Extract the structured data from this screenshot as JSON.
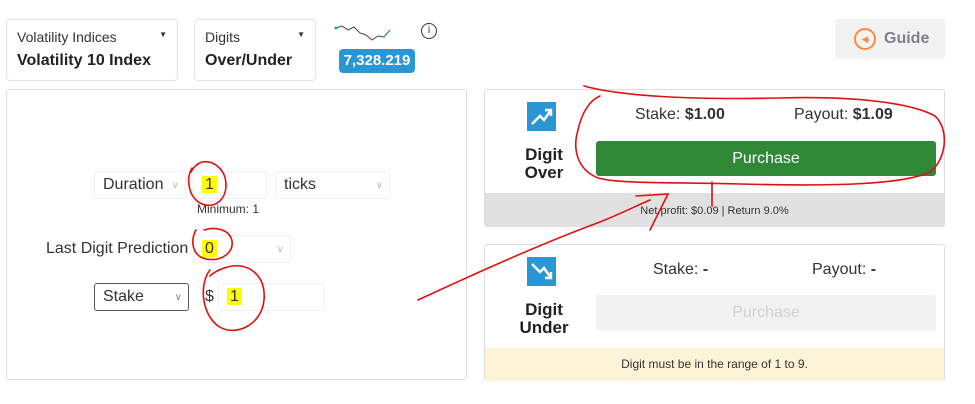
{
  "market": {
    "label": "Volatility Indices",
    "value": "Volatility 10 Index",
    "arrow": "▼"
  },
  "trade_type": {
    "label": "Digits",
    "value": "Over/Under",
    "arrow": "▼"
  },
  "price": "7,328.219",
  "info_icon": "i",
  "guide": {
    "label": "Guide",
    "icon": "compass-icon"
  },
  "form": {
    "duration": {
      "type": "Duration",
      "value": "1",
      "unit": "ticks",
      "minimum": "Minimum: 1"
    },
    "prediction": {
      "label": "Last Digit Prediction",
      "value": "0"
    },
    "stake": {
      "type": "Stake",
      "currency": "$",
      "value": "1"
    }
  },
  "contracts": [
    {
      "name_line1": "Digit",
      "name_line2": "Over",
      "stake_label": "Stake:",
      "stake_value": "$1.00",
      "payout_label": "Payout:",
      "payout_value": "$1.09",
      "button": "Purchase",
      "footer": "Net profit: $0.09 | Return 9.0%"
    },
    {
      "name_line1": "Digit",
      "name_line2": "Under",
      "stake_label": "Stake:",
      "stake_value": "-",
      "payout_label": "Payout:",
      "payout_value": "-",
      "button": "Purchase",
      "footer": "Digit must be in the range of 1 to 9."
    }
  ],
  "colors": {
    "accent": "#2a96d3",
    "purchase": "#2e8836",
    "annotation": "#e01010",
    "highlight": "#ffff00"
  }
}
